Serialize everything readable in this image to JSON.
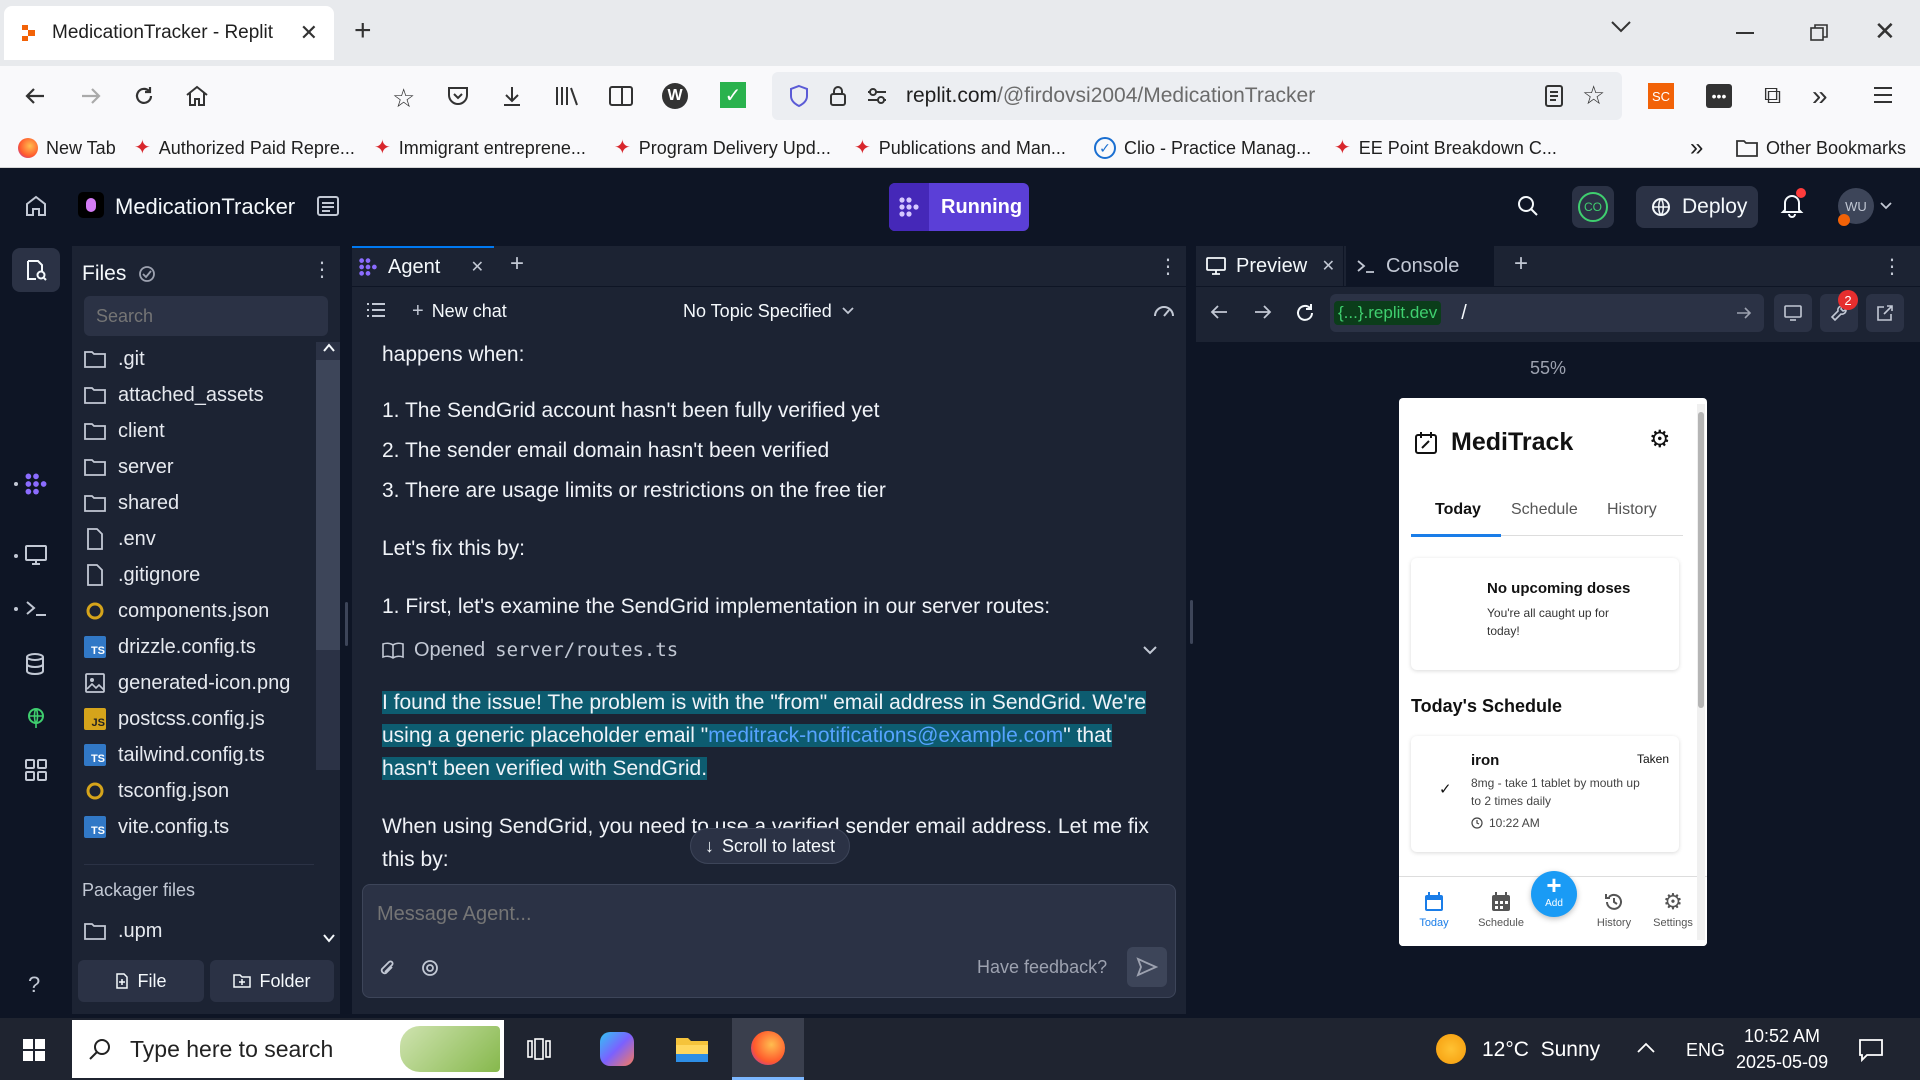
{
  "browser": {
    "tab_title": "MedicationTracker - Replit",
    "url_host": "replit.com",
    "url_path": "/@firdovsi2004/MedicationTracker",
    "bookmarks": [
      "New Tab",
      "Authorized Paid Repre...",
      "Immigrant entreprene...",
      "Program Delivery Upd...",
      "Publications and Man...",
      "Clio - Practice Manag...",
      "EE Point Breakdown C..."
    ],
    "other_bookmarks": "Other Bookmarks",
    "ext_sc": "SC",
    "colors": {
      "accent": "#5b3fd7",
      "tab_bg": "#ffffff",
      "chrome_bg": "#f9f9fb"
    }
  },
  "header": {
    "project_name": "MedicationTracker",
    "run_label": "Running",
    "avatar_co": "CO",
    "deploy_label": "Deploy",
    "user_initials": "WU"
  },
  "files": {
    "title": "Files",
    "search_placeholder": "Search",
    "items": [
      {
        "name": ".git",
        "icon": "folder-icon"
      },
      {
        "name": "attached_assets",
        "icon": "folder-icon"
      },
      {
        "name": "client",
        "icon": "folder-icon"
      },
      {
        "name": "server",
        "icon": "folder-icon"
      },
      {
        "name": "shared",
        "icon": "folder-icon"
      },
      {
        "name": ".env",
        "icon": "file-icon"
      },
      {
        "name": ".gitignore",
        "icon": "file-icon"
      },
      {
        "name": "components.json",
        "icon": "json-icon"
      },
      {
        "name": "drizzle.config.ts",
        "icon": "ts-icon"
      },
      {
        "name": "generated-icon.png",
        "icon": "image-icon"
      },
      {
        "name": "postcss.config.js",
        "icon": "js-icon"
      },
      {
        "name": "tailwind.config.ts",
        "icon": "ts-icon"
      },
      {
        "name": "tsconfig.json",
        "icon": "json-icon"
      },
      {
        "name": "vite.config.ts",
        "icon": "ts-icon"
      }
    ],
    "packager_label": "Packager files",
    "packager_items": [
      {
        "name": ".upm",
        "icon": "folder-icon"
      }
    ],
    "new_file_label": "File",
    "new_folder_label": "Folder",
    "ts_badge": "TS",
    "js_badge": "JS"
  },
  "agent": {
    "tab_label": "Agent",
    "new_chat_label": "New chat",
    "topic_label": "No Topic Specified",
    "lines": {
      "intro": "happens when:",
      "item1": "1. The SendGrid account hasn't been fully verified yet",
      "item2": "2. The sender email domain hasn't been verified",
      "item3": "3. There are usage limits or restrictions on the free tier",
      "fix": "Let's fix this by:",
      "step1": "1. First, let's examine the SendGrid implementation in our server routes:",
      "opened_label": "Opened",
      "opened_file": "server/routes.ts",
      "hl_part1": "I found the issue! The problem is with the \"from\" email address in SendGrid. We're using a generic placeholder email \"",
      "hl_link": "meditrack-notifications@example.com",
      "hl_part2": "\" that hasn't been verified with SendGrid.",
      "last": "When using SendGrid, you need to use a verified sender email address. Let me fix this by:"
    },
    "scroll_label": "Scroll to latest",
    "input_placeholder": "Message Agent...",
    "feedback_label": "Have feedback?"
  },
  "preview": {
    "tab_preview": "Preview",
    "tab_console": "Console",
    "url_domain_badge": "{...}",
    "url_domain": ".replit.dev",
    "url_path": "/",
    "devtools_badge": "2",
    "zoom": "55%",
    "app": {
      "title": "MediTrack",
      "tabs": [
        "Today",
        "Schedule",
        "History"
      ],
      "empty_title": "No upcoming doses",
      "empty_sub": "You're all caught up for today!",
      "schedule_heading": "Today's Schedule",
      "med_name": "iron",
      "med_status": "Taken",
      "med_desc": "8mg - take 1 tablet by mouth up to 2 times daily",
      "med_time": "10:22 AM",
      "nav": [
        "Today",
        "Schedule",
        "Add",
        "History",
        "Settings"
      ]
    }
  },
  "taskbar": {
    "search_placeholder": "Type here to search",
    "weather": "12°C  Sunny",
    "lang": "ENG",
    "time": "10:52 AM",
    "date": "2025-05-09"
  }
}
